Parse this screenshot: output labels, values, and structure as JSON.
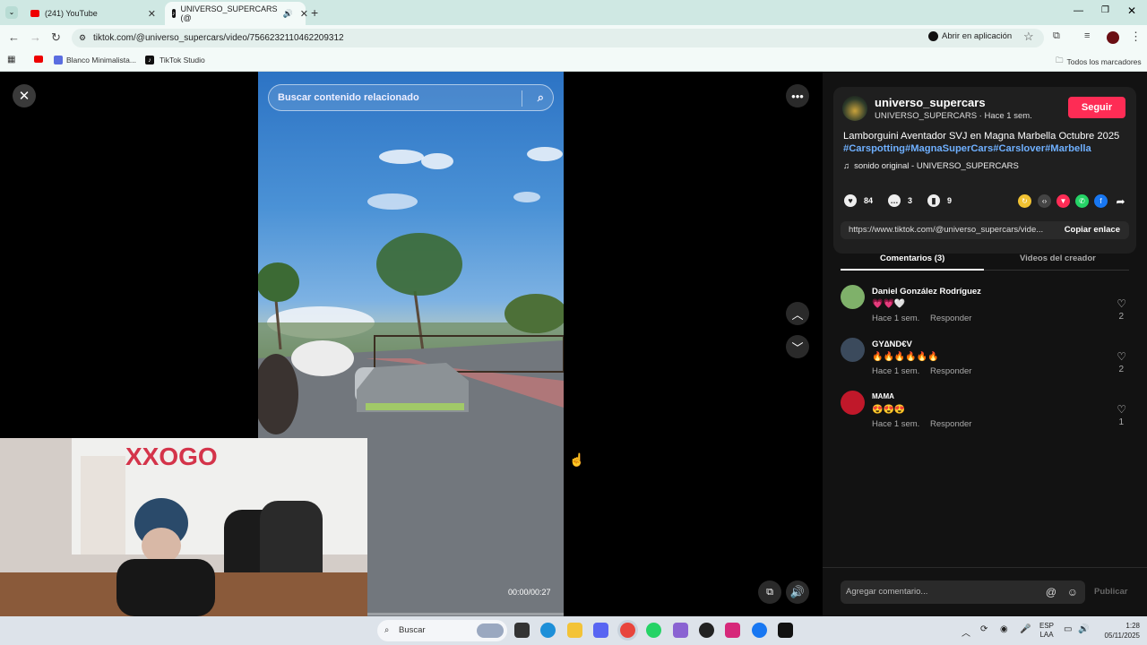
{
  "browser": {
    "tabs": [
      {
        "title": "(241) YouTube",
        "active": false
      },
      {
        "title": "UNIVERSO_SUPERCARS (@",
        "active": true
      }
    ],
    "url": "tiktok.com/@universo_supercars/video/7566232110462209312",
    "open_in_app": "Abrir en aplicación",
    "bookmarks": [
      "Blanco Minimalista...",
      "TikTok Studio"
    ],
    "all_bookmarks": "Todos los marcadores"
  },
  "video": {
    "search_placeholder": "Buscar contenido relacionado",
    "time": "00:00/00:27"
  },
  "panel": {
    "username": "universo_supercars",
    "subline": "UNIVERSO_SUPERCARS · Hace 1 sem.",
    "follow": "Seguir",
    "description": "Lamborguini Aventador SVJ en Magna Marbella Octubre 2025",
    "hashtags": "#Carspotting#MagnaSuperCars#Carslover#Marbella",
    "sound": "sonido original - UNIVERSO_SUPERCARS",
    "likes": "84",
    "comments_count": "3",
    "saves": "9",
    "link": "https://www.tiktok.com/@universo_supercars/vide...",
    "copy_link": "Copiar enlace",
    "tab_comments": "Comentarios (3)",
    "tab_videos": "Videos del creador",
    "comment_placeholder": "Agregar comentario...",
    "publish": "Publicar",
    "comments": [
      {
        "name": "Daniel González Rodríguez",
        "text": "💗💗🤍",
        "time": "Hace 1 sem.",
        "reply": "Responder",
        "likes": "2",
        "avatar_color": "#7fb16a"
      },
      {
        "name": "GY∆ND€V",
        "text": "🔥🔥🔥🔥🔥🔥",
        "time": "Hace 1 sem.",
        "reply": "Responder",
        "likes": "2",
        "avatar_color": "#3b4a5c"
      },
      {
        "name": "MAMA",
        "text": "😍😍😍",
        "time": "Hace 1 sem.",
        "reply": "Responder",
        "likes": "1",
        "avatar_color": "#c0182a"
      }
    ]
  },
  "taskbar": {
    "search": "Buscar",
    "lang": "ESP",
    "lang2": "LAA",
    "time": "1:28",
    "date": "05/11/2025"
  }
}
